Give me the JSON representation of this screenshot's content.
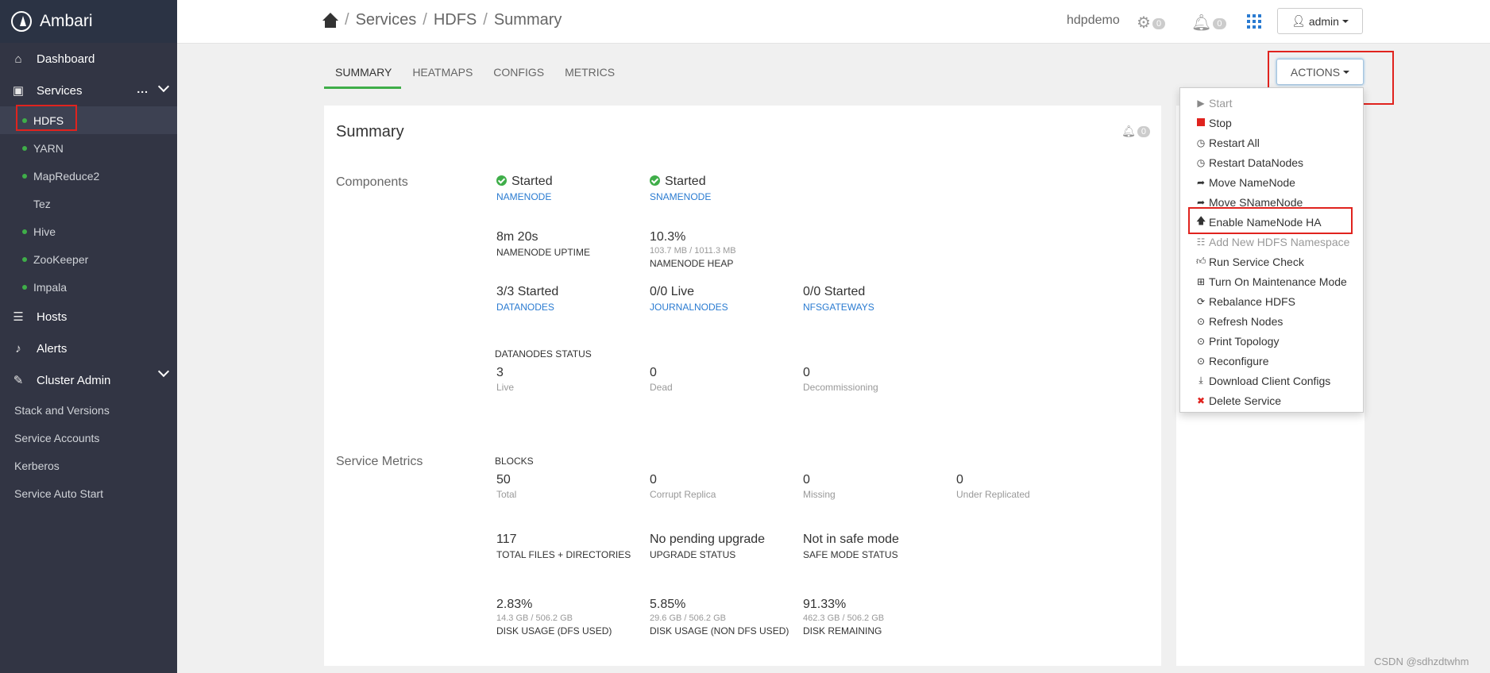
{
  "sidebar": {
    "app_name": "Ambari",
    "dashboard": "Dashboard",
    "services": "Services",
    "services_more": "...",
    "service_items": [
      {
        "label": "HDFS",
        "dot": true
      },
      {
        "label": "YARN",
        "dot": true
      },
      {
        "label": "MapReduce2",
        "dot": true
      },
      {
        "label": "Tez",
        "dot": false
      },
      {
        "label": "Hive",
        "dot": true
      },
      {
        "label": "ZooKeeper",
        "dot": true
      },
      {
        "label": "Impala",
        "dot": true
      }
    ],
    "hosts": "Hosts",
    "alerts": "Alerts",
    "cluster_admin": "Cluster Admin",
    "admin_items": [
      "Stack and Versions",
      "Service Accounts",
      "Kerberos",
      "Service Auto Start"
    ]
  },
  "header": {
    "breadcrumb": [
      "Services",
      "HDFS",
      "Summary"
    ],
    "separator": "/",
    "cluster": "hdpdemo",
    "ops_count": "0",
    "alerts_count": "0",
    "user": "admin"
  },
  "tabs": [
    "SUMMARY",
    "HEATMAPS",
    "CONFIGS",
    "METRICS"
  ],
  "actions_label": "ACTIONS",
  "actions_menu": [
    {
      "label": "Start",
      "icon": "play-icon",
      "disabled": true
    },
    {
      "label": "Stop",
      "icon": "stop-icon",
      "disabled": false
    },
    {
      "label": "Restart All",
      "icon": "clock-icon",
      "disabled": false
    },
    {
      "label": "Restart DataNodes",
      "icon": "clock-icon",
      "disabled": false
    },
    {
      "label": "Move NameNode",
      "icon": "share-icon",
      "disabled": false
    },
    {
      "label": "Move SNameNode",
      "icon": "share-icon",
      "disabled": false
    },
    {
      "label": "Enable NameNode HA",
      "icon": "arrow-up-icon",
      "disabled": false
    },
    {
      "label": "Add New HDFS Namespace",
      "icon": "sitemap-icon",
      "disabled": true
    },
    {
      "label": "Run Service Check",
      "icon": "thumbs-up-icon",
      "disabled": false
    },
    {
      "label": "Turn On Maintenance Mode",
      "icon": "medkit-icon",
      "disabled": false
    },
    {
      "label": "Rebalance HDFS",
      "icon": "refresh-icon",
      "disabled": false
    },
    {
      "label": "Refresh Nodes",
      "icon": "play-circle-icon",
      "disabled": false
    },
    {
      "label": "Print Topology",
      "icon": "play-circle-icon",
      "disabled": false
    },
    {
      "label": "Reconfigure",
      "icon": "play-circle-icon",
      "disabled": false
    },
    {
      "label": "Download Client Configs",
      "icon": "download-icon",
      "disabled": false
    },
    {
      "label": "Delete Service",
      "icon": "remove-icon",
      "disabled": false
    }
  ],
  "summary": {
    "title": "Summary",
    "alerts_count": "0",
    "components_label": "Components",
    "namenode_status": "Started",
    "namenode_link": "NAMENODE",
    "snamenode_status": "Started",
    "snamenode_link": "SNAMENODE",
    "uptime_value": "8m 20s",
    "uptime_label": "NAMENODE UPTIME",
    "heap_value": "10.3%",
    "heap_detail": "103.7 MB / 1011.3 MB",
    "heap_label": "NAMENODE HEAP",
    "datanodes_value": "3/3 Started",
    "datanodes_link": "DATANODES",
    "journal_value": "0/0 Live",
    "journal_link": "JOURNALNODES",
    "nfs_value": "0/0 Started",
    "nfs_link": "NFSGATEWAYS",
    "dn_status_label": "DATANODES STATUS",
    "dn_live": "3",
    "dn_live_label": "Live",
    "dn_dead": "0",
    "dn_dead_label": "Dead",
    "dn_decom": "0",
    "dn_decom_label": "Decommissioning",
    "metrics_label": "Service Metrics",
    "blocks_label": "BLOCKS",
    "blocks_total": "50",
    "blocks_total_label": "Total",
    "blocks_corrupt": "0",
    "blocks_corrupt_label": "Corrupt Replica",
    "blocks_missing": "0",
    "blocks_missing_label": "Missing",
    "blocks_under": "0",
    "blocks_under_label": "Under Replicated",
    "files_value": "117",
    "files_label": "TOTAL FILES + DIRECTORIES",
    "upgrade_value": "No pending upgrade",
    "upgrade_label": "UPGRADE STATUS",
    "safe_value": "Not in safe mode",
    "safe_label": "SAFE MODE STATUS",
    "dfs_value": "2.83%",
    "dfs_detail": "14.3 GB / 506.2 GB",
    "dfs_label": "DISK USAGE (DFS USED)",
    "nondfs_value": "5.85%",
    "nondfs_detail": "29.6 GB / 506.2 GB",
    "nondfs_label": "DISK USAGE (NON DFS USED)",
    "remain_value": "91.33%",
    "remain_detail": "462.3 GB / 506.2 GB",
    "remain_label": "DISK REMAINING"
  },
  "watermark": "CSDN @sdhzdtwhm",
  "colors": {
    "accent_green": "#3fae49",
    "link_blue": "#2a7bd1",
    "highlight_red": "#e0231e",
    "sidebar_bg": "#323544"
  }
}
